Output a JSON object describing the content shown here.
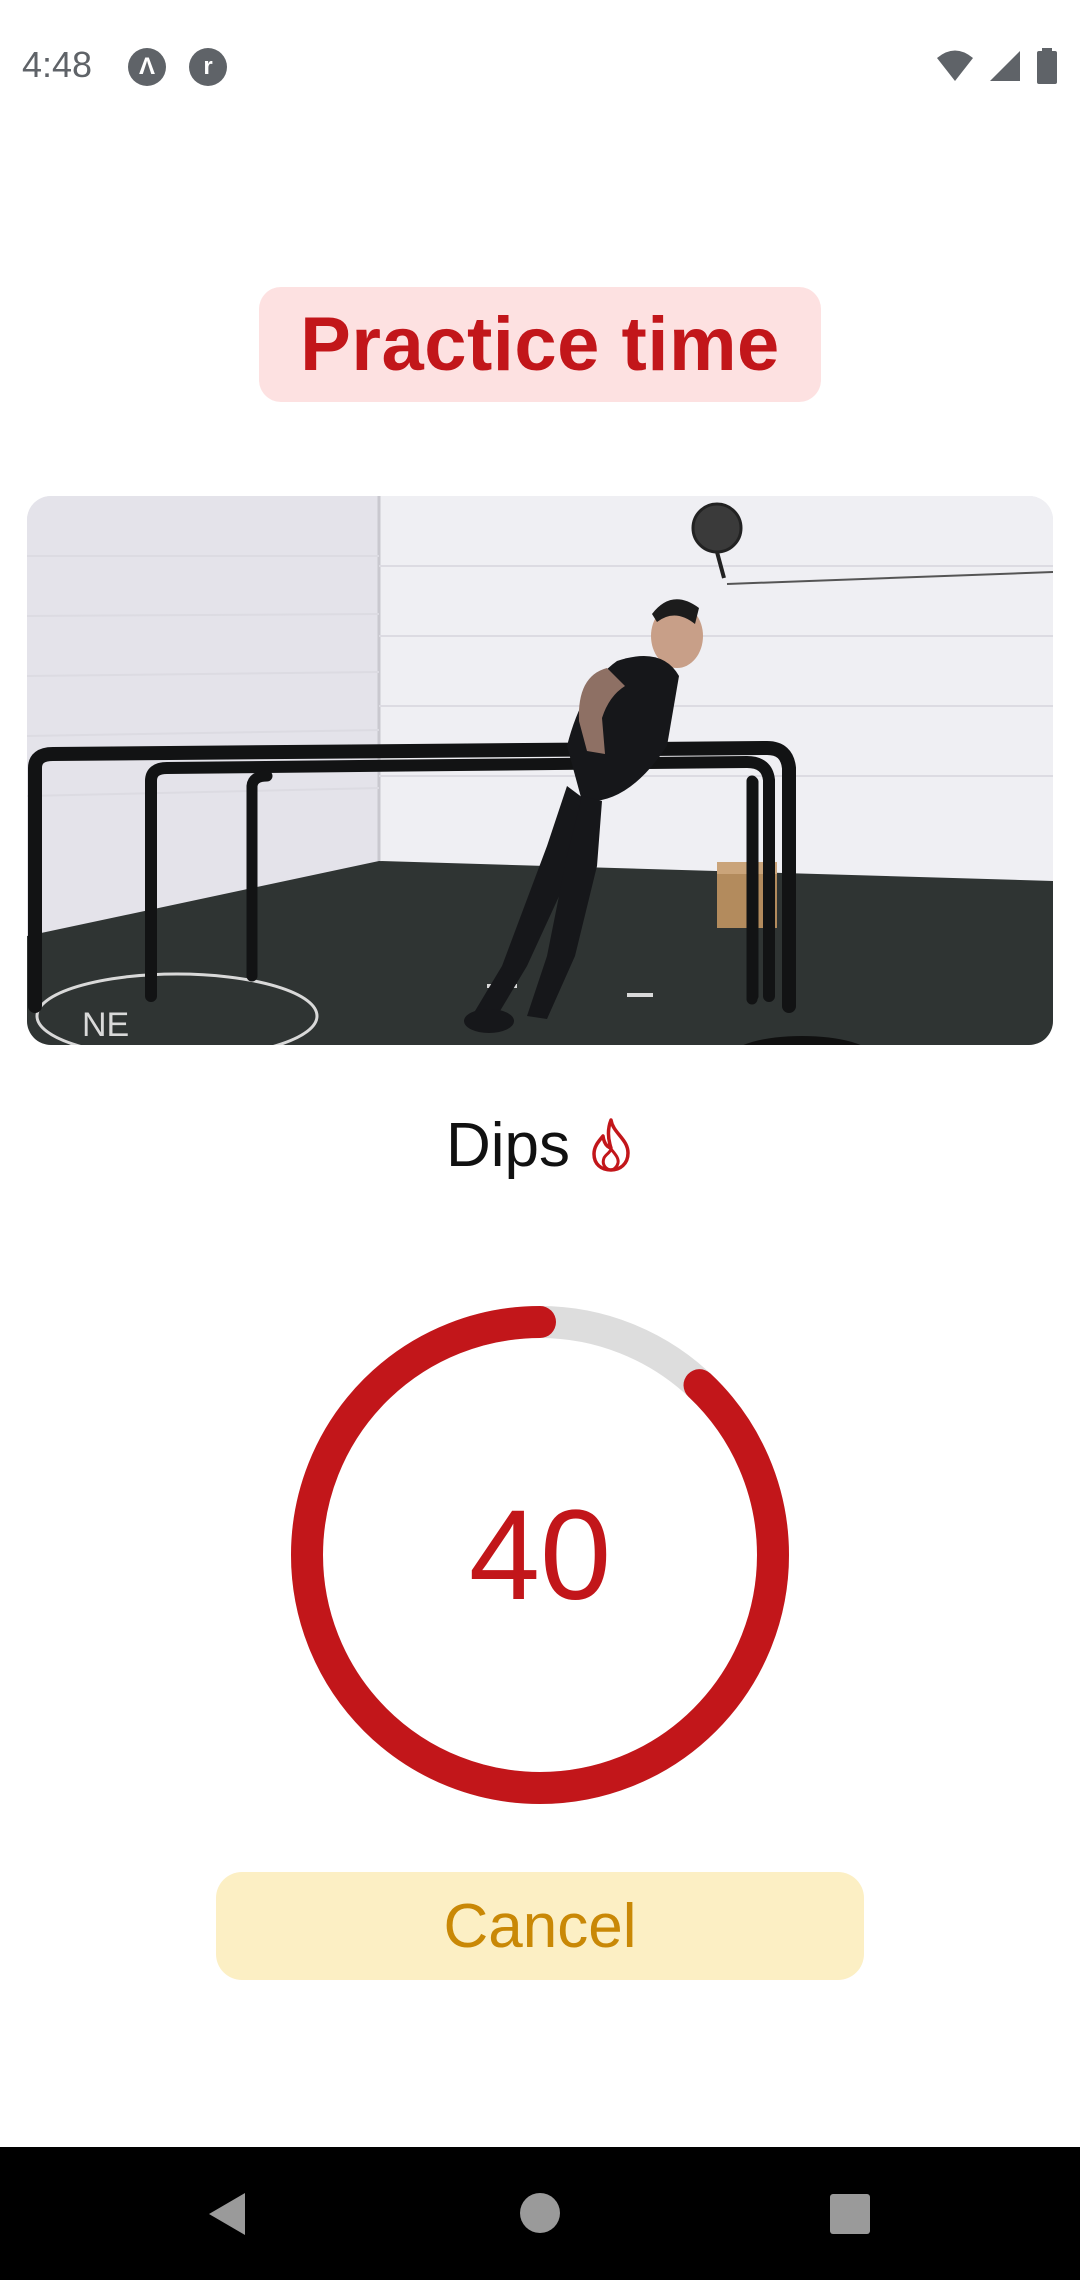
{
  "status": {
    "time": "4:48"
  },
  "header": {
    "title": "Practice time"
  },
  "exercise": {
    "name": "Dips",
    "icon": "flame-icon"
  },
  "timer": {
    "value": "40",
    "progress_fraction": 0.88,
    "track_color": "#dddddd",
    "fill_color": "#c2161a"
  },
  "actions": {
    "cancel_label": "Cancel"
  },
  "colors": {
    "accent": "#c2161a",
    "title_bg": "#fde1e1",
    "cancel_bg": "#fcefc4",
    "cancel_text": "#c98806"
  }
}
